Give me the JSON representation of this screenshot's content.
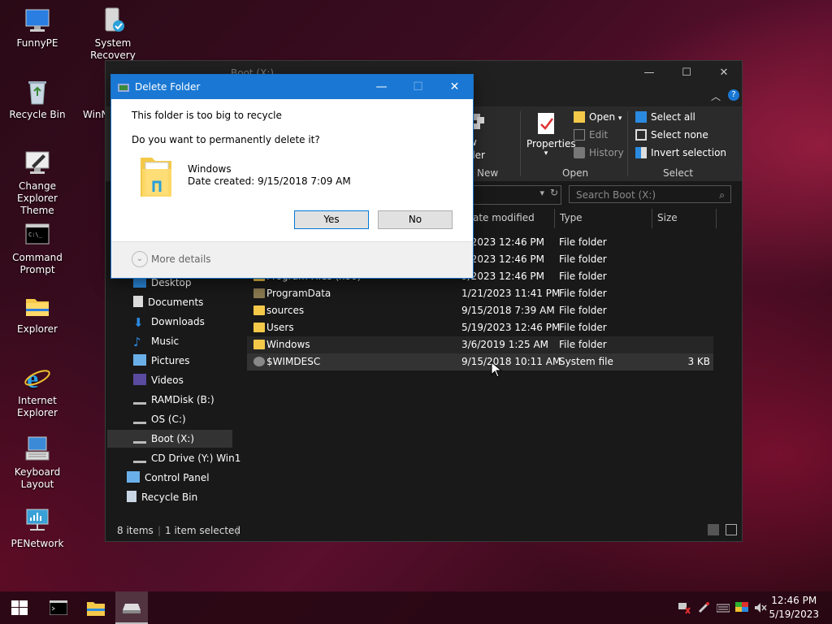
{
  "desktop": {
    "icons": [
      {
        "label": "FunnyPE"
      },
      {
        "label": "System Recovery"
      },
      {
        "label": "Recycle Bin"
      },
      {
        "label": "WinN"
      },
      {
        "label": "Change Explorer Theme"
      },
      {
        "label": "Command Prompt"
      },
      {
        "label": "Explorer"
      },
      {
        "label": "Internet Explorer"
      },
      {
        "label": "Keyboard Layout"
      },
      {
        "label": "PENetwork"
      }
    ]
  },
  "explorer": {
    "title": "Boot (X:)",
    "ribbon": {
      "new_partial": "w",
      "new_partial2": "der",
      "properties": "Properties",
      "open": "Open",
      "edit": "Edit",
      "history": "History",
      "select_all": "Select all",
      "select_none": "Select none",
      "invert_selection": "Invert selection",
      "groups": {
        "new": "New",
        "open": "Open",
        "select": "Select"
      }
    },
    "search_placeholder": "Search Boot (X:)",
    "columns": {
      "date": "ate modified",
      "type": "Type",
      "size": "Size"
    },
    "nav": [
      {
        "label": "Desktop"
      },
      {
        "label": "Documents"
      },
      {
        "label": "Downloads"
      },
      {
        "label": "Music"
      },
      {
        "label": "Pictures"
      },
      {
        "label": "Videos"
      },
      {
        "label": "RAMDisk (B:)"
      },
      {
        "label": "OS (C:)"
      },
      {
        "label": "Boot (X:)"
      },
      {
        "label": "CD Drive (Y:) Win1"
      },
      {
        "label": "Control Panel"
      },
      {
        "label": "Recycle Bin"
      }
    ],
    "files": [
      {
        "name": "",
        "date": "9/2023 12:46 PM",
        "type": "File folder",
        "size": ""
      },
      {
        "name": "",
        "date": "9/2023 12:46 PM",
        "type": "File folder",
        "size": ""
      },
      {
        "name": "Program Files (x86)",
        "date": "9/2023 12:46 PM",
        "type": "File folder",
        "size": ""
      },
      {
        "name": "ProgramData",
        "date": "1/21/2023 11:41 PM",
        "type": "File folder",
        "size": ""
      },
      {
        "name": "sources",
        "date": "9/15/2018 7:39 AM",
        "type": "File folder",
        "size": ""
      },
      {
        "name": "Users",
        "date": "5/19/2023 12:46 PM",
        "type": "File folder",
        "size": ""
      },
      {
        "name": "Windows",
        "date": "3/6/2019 1:25 AM",
        "type": "File folder",
        "size": ""
      },
      {
        "name": "$WIMDESC",
        "date": "9/15/2018 10:11 AM",
        "type": "System file",
        "size": "3 KB"
      }
    ],
    "status": {
      "items": "8 items",
      "selected": "1 item selected"
    }
  },
  "dialog": {
    "title": "Delete Folder",
    "line1": "This folder is too big to recycle",
    "line2": "Do you want to permanently delete it?",
    "item_name": "Windows",
    "item_date": "Date created: 9/15/2018 7:09 AM",
    "yes": "Yes",
    "no": "No",
    "more_details": "More details"
  },
  "taskbar": {
    "time": "12:46 PM",
    "date": "5/19/2023"
  },
  "colors": {
    "accent": "#1a78d4",
    "folder": "#f4c94a"
  }
}
